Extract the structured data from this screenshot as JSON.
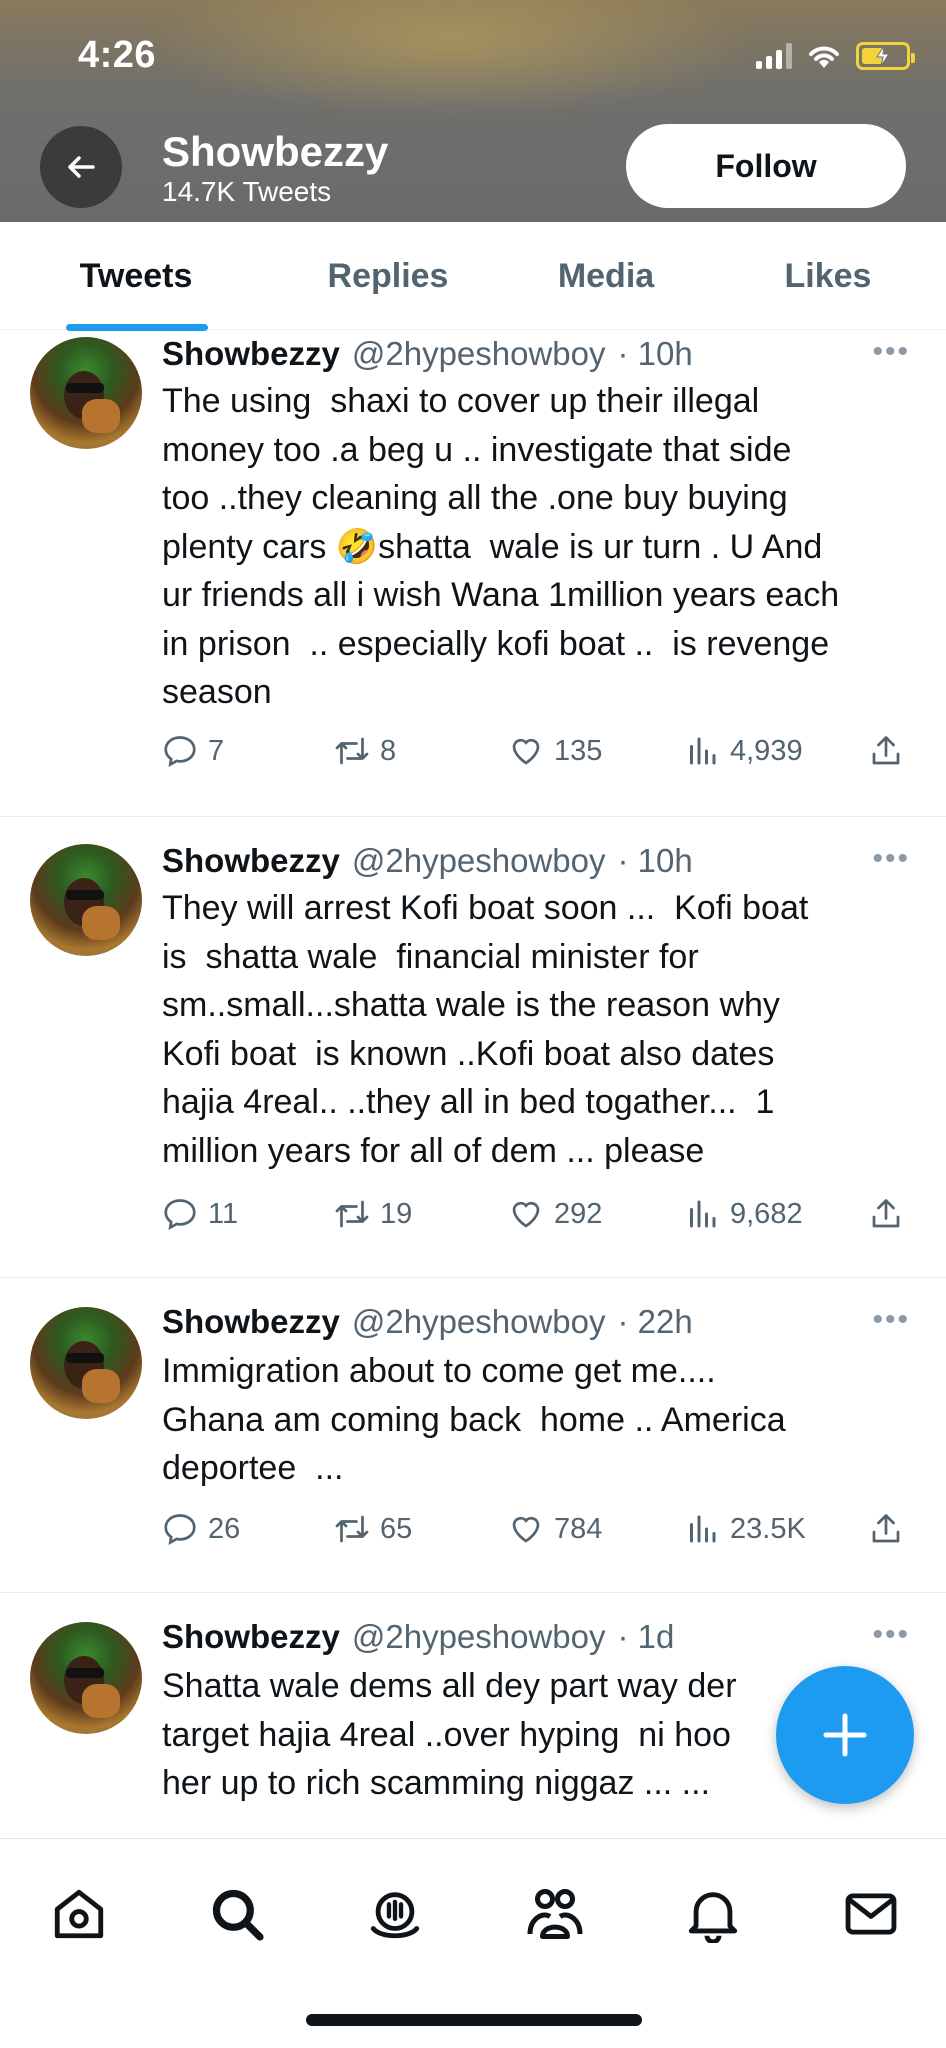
{
  "status_bar": {
    "time": "4:26"
  },
  "header": {
    "name": "Showbezzy",
    "tweet_count": "14.7K Tweets",
    "follow_label": "Follow"
  },
  "tabs": [
    {
      "label": "Tweets",
      "active": true
    },
    {
      "label": "Replies",
      "active": false
    },
    {
      "label": "Media",
      "active": false
    },
    {
      "label": "Likes",
      "active": false
    }
  ],
  "tweets": [
    {
      "name": "Showbezzy",
      "handle": "@2hypeshowboy",
      "time": "· 10h",
      "text": "The using  shaxi to cover up their illegal\nmoney too .a beg u .. investigate that side\ntoo ..they cleaning all the .one buy buying\nplenty cars 🤣shatta  wale is ur turn . U And\nur friends all i wish Wana 1million years each\nin prison  .. especially kofi boat ..  is revenge\nseason",
      "replies": "7",
      "retweets": "8",
      "likes": "135",
      "views": "4,939"
    },
    {
      "name": "Showbezzy",
      "handle": "@2hypeshowboy",
      "time": "· 10h",
      "text": "They will arrest Kofi boat soon ...  Kofi boat\nis  shatta wale  financial minister for\nsm..small...shatta wale is the reason why\nKofi boat  is known ..Kofi boat also dates\nhajia 4real.. ..they all in bed togather...  1\nmillion years for all of dem ... please",
      "replies": "11",
      "retweets": "19",
      "likes": "292",
      "views": "9,682"
    },
    {
      "name": "Showbezzy",
      "handle": "@2hypeshowboy",
      "time": "· 22h",
      "text": "Immigration about to come get me....\nGhana am coming back  home .. America\ndeportee  ...",
      "replies": "26",
      "retweets": "65",
      "likes": "784",
      "views": "23.5K"
    },
    {
      "name": "Showbezzy",
      "handle": "@2hypeshowboy",
      "time": "· 1d",
      "text": "Shatta wale dems all dey part way der\ntarget hajia 4real ..over hyping  ni hoo\nher up to rich scamming niggaz ... ..."
    }
  ],
  "colors": {
    "accent": "#1d9bf0",
    "text": "#0f1419",
    "secondary": "#536471"
  },
  "icons": {
    "nav": [
      "home-icon",
      "search-icon",
      "spaces-icon",
      "communities-icon",
      "notifications-icon",
      "messages-icon"
    ],
    "actions": [
      "reply-icon",
      "retweet-icon",
      "like-icon",
      "views-icon",
      "share-icon"
    ]
  }
}
